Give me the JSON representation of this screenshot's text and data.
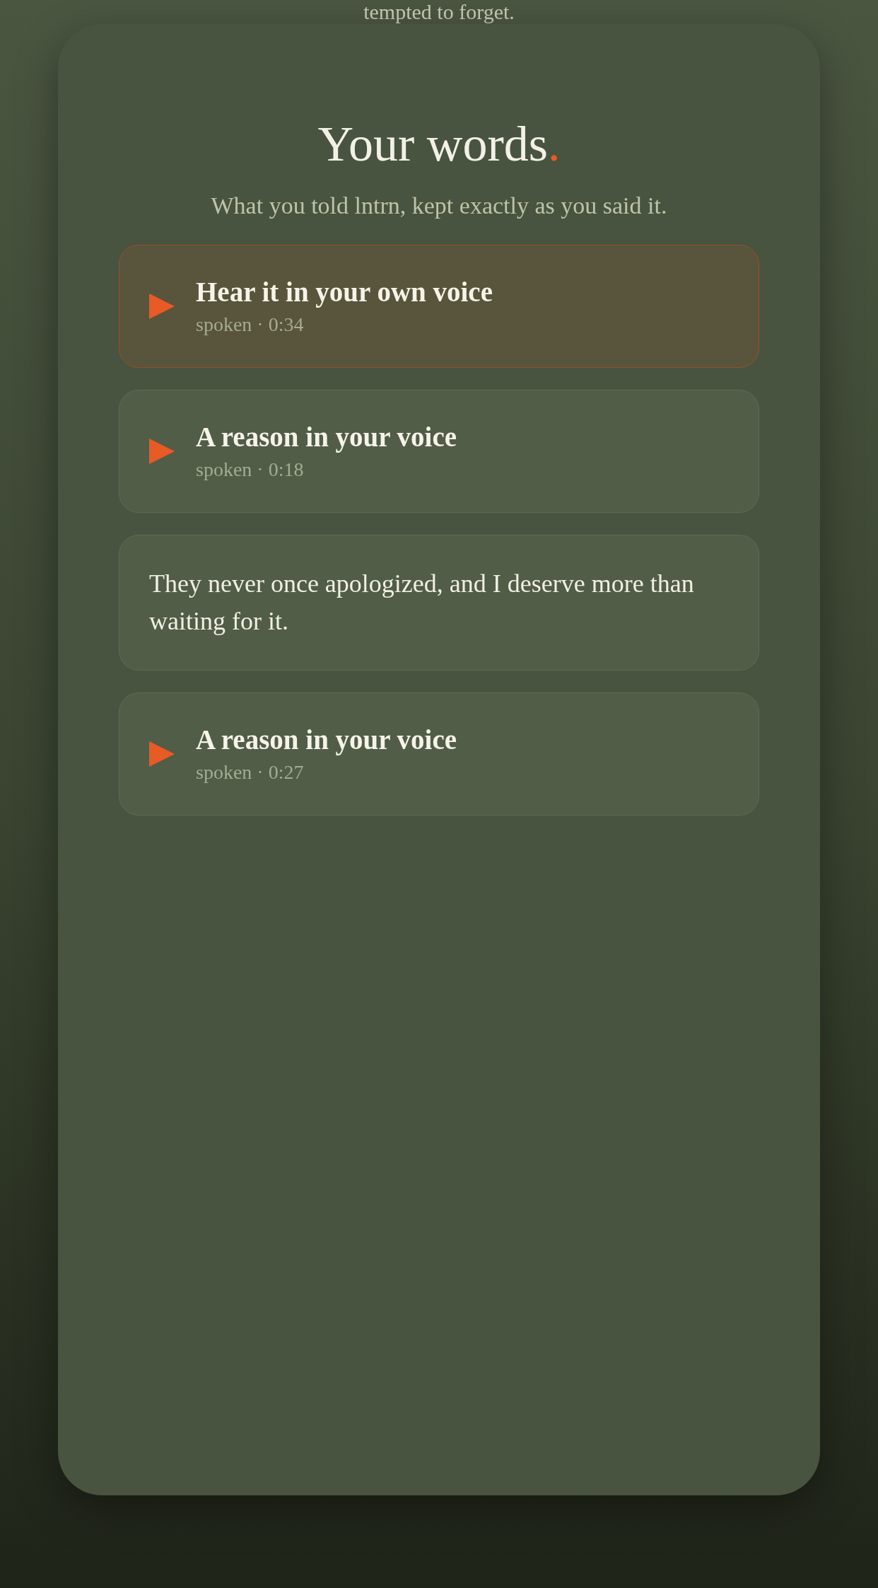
{
  "top_text": "tempted to forget.",
  "heading": {
    "text": "Your words",
    "accent": "."
  },
  "subtitle": "What you told lntrn, kept exactly as you said it.",
  "entries": [
    {
      "kind": "audio",
      "selected": true,
      "title": "Hear it in your own voice",
      "meta": "spoken · 0:34"
    },
    {
      "kind": "audio",
      "selected": false,
      "title": "A reason in your voice",
      "meta": "spoken · 0:18"
    },
    {
      "kind": "text",
      "text": "They never once apologized, and I deserve more than waiting for it."
    },
    {
      "kind": "audio",
      "selected": false,
      "title": "A reason in your voice",
      "meta": "spoken · 0:27"
    }
  ]
}
